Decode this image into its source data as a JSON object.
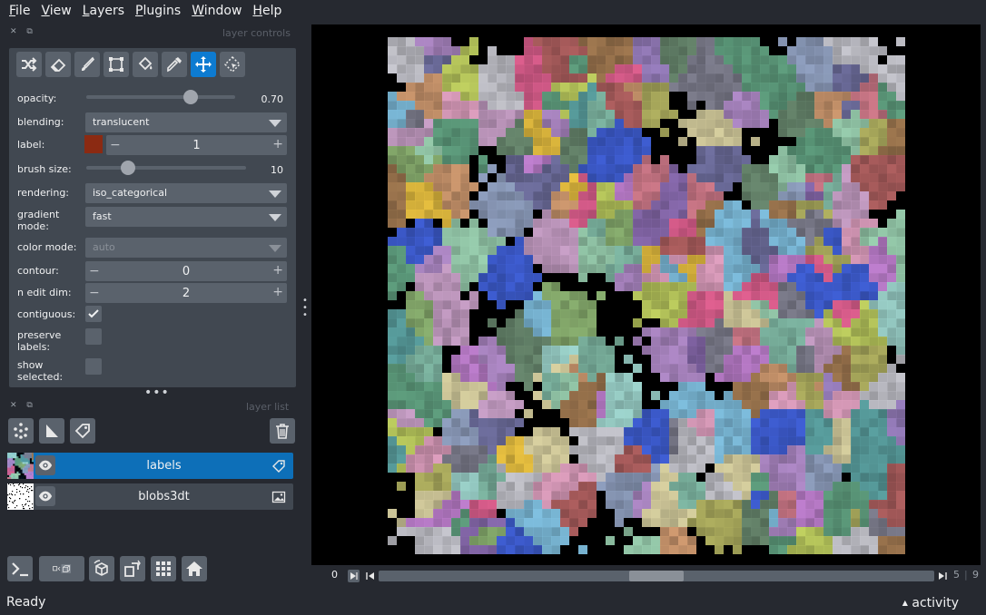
{
  "menubar": {
    "items": [
      {
        "label": "File",
        "key": "F",
        "rest": "ile"
      },
      {
        "label": "View",
        "key": "V",
        "rest": "iew"
      },
      {
        "label": "Layers",
        "key": "L",
        "rest": "ayers"
      },
      {
        "label": "Plugins",
        "key": "P",
        "rest": "lugins"
      },
      {
        "label": "Window",
        "key": "W",
        "rest": "indow"
      },
      {
        "label": "Help",
        "key": "H",
        "rest": "elp"
      }
    ]
  },
  "layer_controls": {
    "title": "layer controls",
    "tools": [
      "shuffle-icon",
      "eraser-icon",
      "paint-brush-icon",
      "polygon-icon",
      "fill-bucket-icon",
      "color-picker-icon",
      "move-icon",
      "transform-icon"
    ],
    "opacity": {
      "label": "opacity:",
      "value": "0.70",
      "fraction": 0.7
    },
    "blending": {
      "label": "blending:",
      "value": "translucent"
    },
    "label": {
      "label": "label:",
      "value": "1",
      "swatch": "#8b2a12"
    },
    "brush_size": {
      "label": "brush size:",
      "value": "10",
      "fraction": 0.26
    },
    "rendering": {
      "label": "rendering:",
      "value": "iso_categorical"
    },
    "gradient_mode": {
      "label_line1": "gradient",
      "label_line2": "mode:",
      "value": "fast"
    },
    "color_mode": {
      "label": "color mode:",
      "value": "auto"
    },
    "contour": {
      "label": "contour:",
      "value": "0"
    },
    "n_edit_dim": {
      "label": "n edit dim:",
      "value": "2"
    },
    "contiguous": {
      "label": "contiguous:",
      "checked": true
    },
    "preserve_labels": {
      "label_line1": "preserve",
      "label_line2": "labels:",
      "checked": false
    },
    "show_selected": {
      "label_line1": "show",
      "label_line2": "selected:",
      "checked": false
    }
  },
  "layer_list": {
    "title": "layer list",
    "buttons": [
      "new-points-icon",
      "new-shapes-icon",
      "new-labels-icon",
      "delete-layer-icon"
    ],
    "layers": [
      {
        "name": "labels",
        "type_icon": "labels-tag-icon",
        "selected": true
      },
      {
        "name": "blobs3dt",
        "type_icon": "image-icon",
        "selected": false
      }
    ]
  },
  "bottom_buttons": [
    "console-icon",
    "ndisplay-toggle-icon",
    "roll-icon",
    "transpose-icon",
    "grid-icon",
    "home-icon"
  ],
  "dims": {
    "current": "0",
    "frame": "5",
    "total": "9",
    "fraction": 0.5
  },
  "status": {
    "text": "Ready"
  },
  "activity": {
    "text": "activity"
  },
  "colors": {
    "accent": "#0d7bd1",
    "background": "#262930",
    "panel": "#414851"
  }
}
